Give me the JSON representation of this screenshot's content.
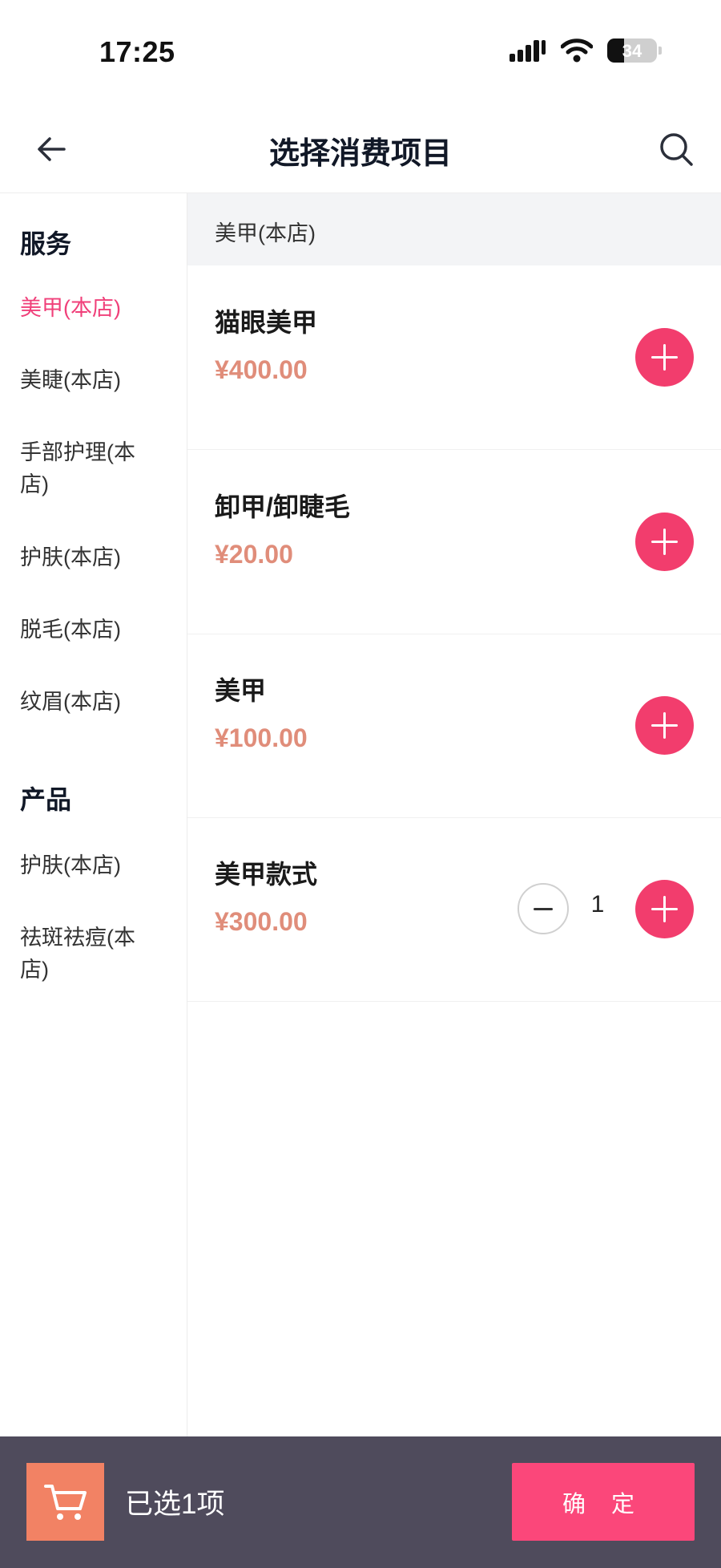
{
  "status_bar": {
    "time": "17:25",
    "battery": "34"
  },
  "header": {
    "title": "选择消费项目",
    "back_icon": "arrow-left-icon",
    "search_icon": "search-icon"
  },
  "sidebar": {
    "groups": [
      {
        "label": "服务"
      },
      {
        "label": "产品"
      }
    ],
    "items": [
      {
        "label": "美甲(本店)",
        "active": true
      },
      {
        "label": "美睫(本店)"
      },
      {
        "label": "手部护理(本店)"
      },
      {
        "label": "护肤(本店)"
      },
      {
        "label": "脱毛(本店)"
      },
      {
        "label": "纹眉(本店)"
      },
      {
        "label": "护肤(本店)"
      },
      {
        "label": "祛斑祛痘(本店)"
      }
    ]
  },
  "main": {
    "section_title": "美甲(本店)",
    "products": [
      {
        "name": "猫眼美甲",
        "price": "¥400.00"
      },
      {
        "name": "卸甲/卸睫毛",
        "price": "¥20.00"
      },
      {
        "name": "美甲",
        "price": "¥100.00"
      },
      {
        "name": "美甲款式",
        "price": "¥300.00",
        "quantity": "1"
      }
    ]
  },
  "bottom_bar": {
    "selected_text": "已选1项",
    "confirm_label": "确 定",
    "cart_icon": "cart-icon"
  },
  "colors": {
    "accent": "#f23d6d",
    "price": "#e08d7a",
    "bar": "#4f4b5c",
    "cart": "#f28264",
    "active": "#f0407a"
  }
}
